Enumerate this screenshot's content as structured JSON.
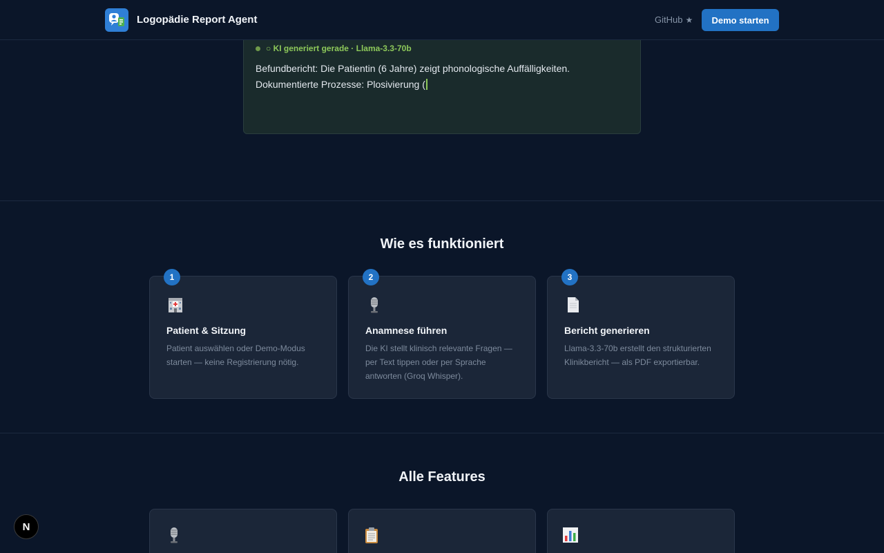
{
  "header": {
    "brand": "Logopädie Report Agent",
    "github_label": "GitHub",
    "github_icon": "star-icon",
    "demo_button": "Demo starten"
  },
  "ai_panel": {
    "status": "○ KI generiert gerade · Llama-3.3-70b",
    "text": "Befundbericht: Die Patientin (6 Jahre) zeigt phonologische Auffälligkeiten. Dokumentierte Prozesse: Plosivierung ("
  },
  "how_it_works": {
    "title": "Wie es funktioniert",
    "steps": [
      {
        "number": "1",
        "icon": "hospital-icon",
        "title": "Patient & Sitzung",
        "desc": "Patient auswählen oder Demo-Modus starten — keine Registrierung nötig."
      },
      {
        "number": "2",
        "icon": "microphone-icon",
        "title": "Anamnese führen",
        "desc": "Die KI stellt klinisch relevante Fragen — per Text tippen oder per Sprache antworten (Groq Whisper)."
      },
      {
        "number": "3",
        "icon": "document-icon",
        "title": "Bericht generieren",
        "desc": "Llama-3.3-70b erstellt den strukturierten Klinikbericht — als PDF exportierbar."
      }
    ]
  },
  "features": {
    "title": "Alle Features",
    "items": [
      {
        "icon": "microphone-icon"
      },
      {
        "icon": "clipboard-icon"
      },
      {
        "icon": "bar-chart-icon"
      }
    ]
  },
  "colors": {
    "background": "#0b1629",
    "accent": "#2272c4",
    "status_green": "#8dc85a",
    "card": "#1b2638"
  },
  "floating_badge": "N"
}
